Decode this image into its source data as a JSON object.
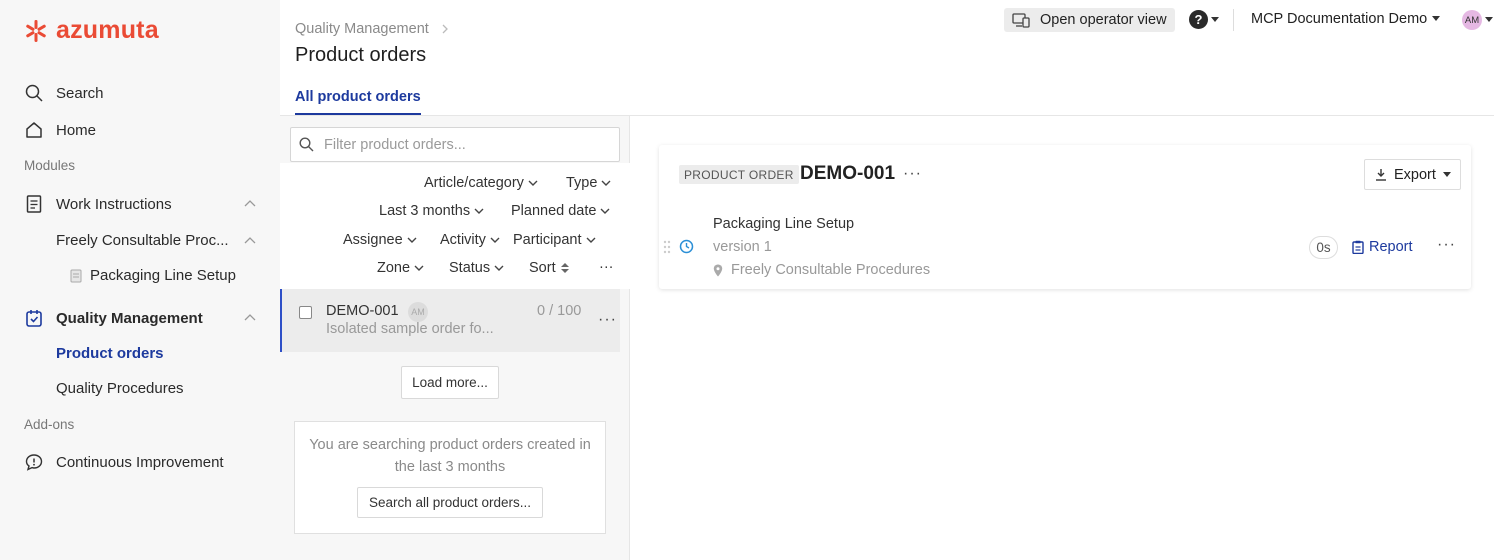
{
  "brand": {
    "name": "azumuta",
    "color": "#ea4b35"
  },
  "colors": {
    "accent": "#1d3a9e",
    "active_border": "#2e4fc7",
    "sidebar_bg": "#f7f7f7"
  },
  "sidebar": {
    "search": "Search",
    "home": "Home",
    "modules_label": "Modules",
    "work_instructions": "Work Instructions",
    "freely_consultable": "Freely Consultable Proc...",
    "packaging_line_setup": "Packaging Line Setup",
    "quality_management": "Quality Management",
    "product_orders": "Product orders",
    "quality_procedures": "Quality Procedures",
    "addons_label": "Add-ons",
    "continuous_improvement": "Continuous Improvement"
  },
  "header": {
    "breadcrumb": "Quality Management",
    "title": "Product orders",
    "tab": "All product orders",
    "operator_view": "Open operator view",
    "help_icon": "?",
    "workspace": "MCP Documentation Demo",
    "avatar": "AM"
  },
  "list": {
    "filter_placeholder": "Filter product orders...",
    "filters": {
      "article": "Article/category",
      "type": "Type",
      "period": "Last 3 months",
      "planned_date": "Planned date",
      "assignee": "Assignee",
      "activity": "Activity",
      "participant": "Participant",
      "zone": "Zone",
      "status": "Status",
      "sort": "Sort",
      "more": "···"
    },
    "order": {
      "id": "DEMO-001",
      "avatar": "AM",
      "progress": "0 / 100",
      "description": "Isolated sample order fo...",
      "more": "···"
    },
    "load_more": "Load more...",
    "info_text": "You are searching product orders created in the last 3 months",
    "search_all": "Search all product orders..."
  },
  "detail": {
    "badge": "PRODUCT ORDER",
    "title": "DEMO-001",
    "more": "···",
    "export": "Export",
    "procedure": {
      "name": "Packaging Line Setup",
      "version": "version 1",
      "location": "Freely Consultable Procedures",
      "timer": "0s",
      "report": "Report",
      "more": "···"
    }
  }
}
